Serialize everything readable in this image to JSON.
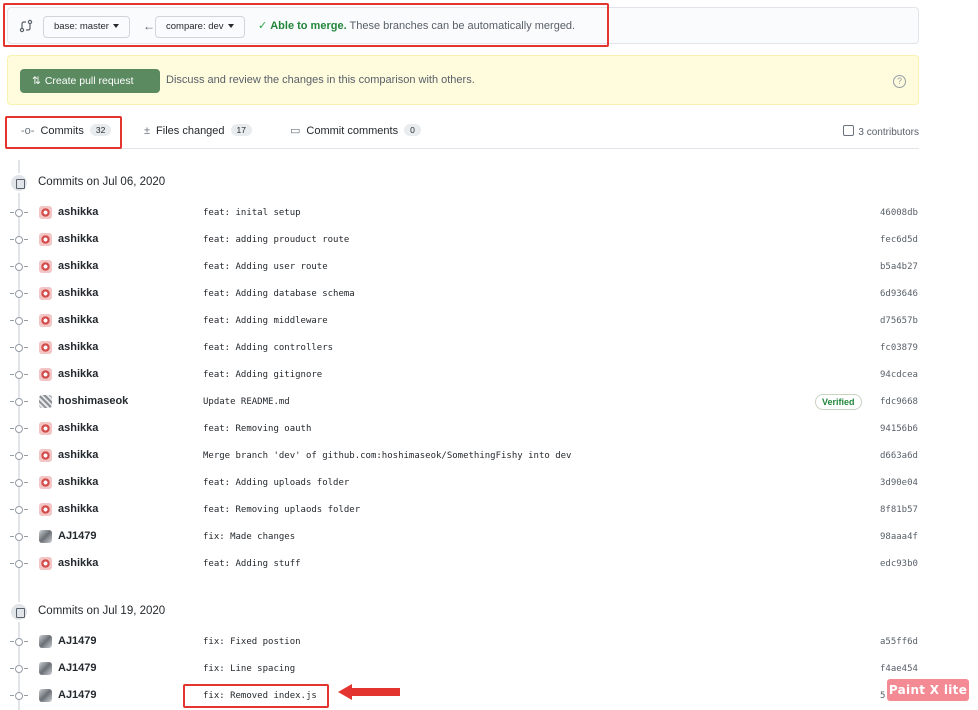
{
  "compare": {
    "base_label": "base: master",
    "compare_label": "compare: dev",
    "merge_bold": "Able to merge.",
    "merge_text": "These branches can be automatically merged."
  },
  "pr_banner": {
    "button_label": "Create pull request",
    "description": "Discuss and review the changes in this comparison with others."
  },
  "tabs": [
    {
      "label": "Commits",
      "count": "32"
    },
    {
      "label": "Files changed",
      "count": "17"
    },
    {
      "label": "Commit comments",
      "count": "0"
    }
  ],
  "contributors_label": "3 contributors",
  "groups": [
    {
      "title": "Commits on Jul 06, 2020",
      "commits": [
        {
          "author": "ashikka",
          "message": "feat: inital setup",
          "sha": "46008db"
        },
        {
          "author": "ashikka",
          "message": "feat: adding prouduct route",
          "sha": "fec6d5d"
        },
        {
          "author": "ashikka",
          "message": "feat: Adding user route",
          "sha": "b5a4b27"
        },
        {
          "author": "ashikka",
          "message": "feat: Adding database schema",
          "sha": "6d93646"
        },
        {
          "author": "ashikka",
          "message": "feat: Adding middleware",
          "sha": "d75657b"
        },
        {
          "author": "ashikka",
          "message": "feat: Adding controllers",
          "sha": "fc03879"
        },
        {
          "author": "ashikka",
          "message": "feat: Adding gitignore",
          "sha": "94cdcea"
        },
        {
          "author": "hoshimaseok",
          "message": "Update README.md",
          "sha": "fdc9668",
          "badge": "Verified"
        },
        {
          "author": "ashikka",
          "message": "feat: Removing oauth",
          "sha": "94156b6"
        },
        {
          "author": "ashikka",
          "message": "Merge branch 'dev' of github.com:hoshimaseok/SomethingFishy into dev",
          "sha": "d663a6d"
        },
        {
          "author": "ashikka",
          "message": "feat: Adding uploads folder",
          "sha": "3d90e04"
        },
        {
          "author": "ashikka",
          "message": "feat: Removing uplaods folder",
          "sha": "8f81b57"
        },
        {
          "author": "AJ1479",
          "message": "fix: Made changes",
          "sha": "98aaa4f"
        },
        {
          "author": "ashikka",
          "message": "feat: Adding stuff",
          "sha": "edc93b0"
        }
      ]
    },
    {
      "title": "Commits on Jul 19, 2020",
      "commits": [
        {
          "author": "AJ1479",
          "message": "fix: Fixed postion",
          "sha": "a55ff6d"
        },
        {
          "author": "AJ1479",
          "message": "fix: Line spacing",
          "sha": "f4ae454"
        },
        {
          "author": "AJ1479",
          "message": "fix: Removed index.js",
          "sha": "5"
        }
      ]
    }
  ],
  "watermark": "Paint X lite",
  "colors": {
    "annotation_red": "#e3342f",
    "create_pr_green": "#5b8a60",
    "merge_green": "#22863a",
    "banner_yellow": "#fffbdd"
  },
  "icons": {
    "compare": "git-compare-icon",
    "pull_request": "git-pull-request-icon",
    "commit": "git-commit-icon",
    "file_diff": "file-diff-icon",
    "comment": "comment-icon",
    "contributors": "people-icon",
    "help": "question-icon",
    "check": "check-icon",
    "arrow": "arrow-left-icon"
  }
}
